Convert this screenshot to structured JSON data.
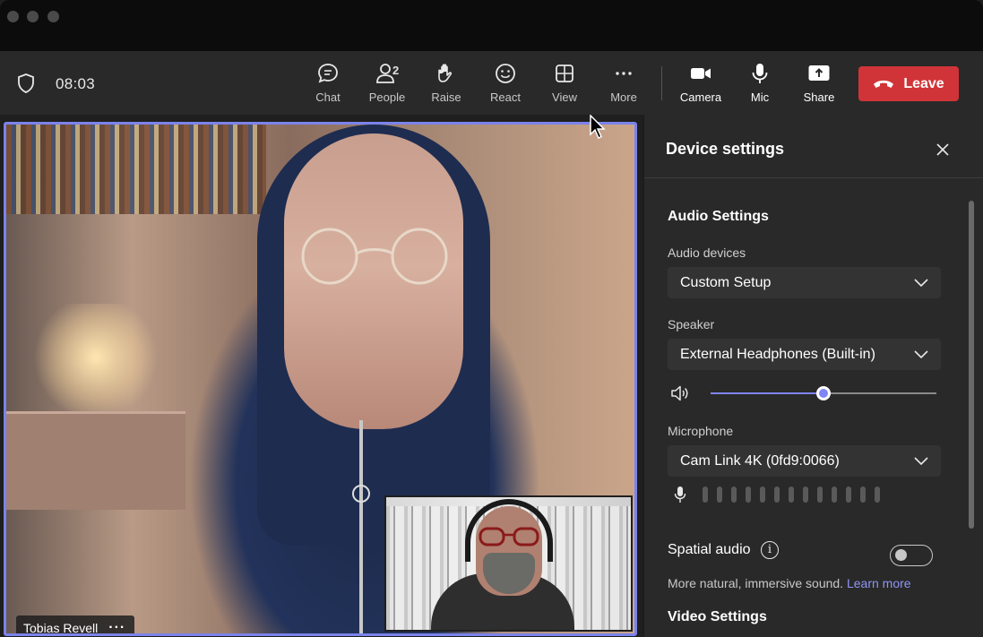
{
  "toolbar": {
    "timer": "08:03",
    "chat_label": "Chat",
    "people_label": "People",
    "people_count": "2",
    "raise_label": "Raise",
    "react_label": "React",
    "view_label": "View",
    "more_label": "More",
    "camera_label": "Camera",
    "mic_label": "Mic",
    "share_label": "Share",
    "leave_label": "Leave"
  },
  "stage": {
    "participant_name": "Tobias Revell",
    "more_glyph": "···"
  },
  "panel": {
    "title": "Device settings",
    "audio_settings_title": "Audio Settings",
    "audio_devices_label": "Audio devices",
    "audio_devices_value": "Custom Setup",
    "speaker_label": "Speaker",
    "speaker_value": "External Headphones (Built-in)",
    "speaker_volume": 0.5,
    "microphone_label": "Microphone",
    "microphone_value": "Cam Link 4K (0fd9:0066)",
    "mic_level_bars": 13,
    "spatial_audio_label": "Spatial audio",
    "spatial_audio_on": false,
    "spatial_audio_desc": "More natural, immersive sound.",
    "learn_more": "Learn more",
    "video_settings_title": "Video Settings"
  },
  "colors": {
    "accent": "#7f85f5",
    "leave": "#d13438",
    "panel_bg": "#292929",
    "toolbar_bg": "#292929"
  }
}
